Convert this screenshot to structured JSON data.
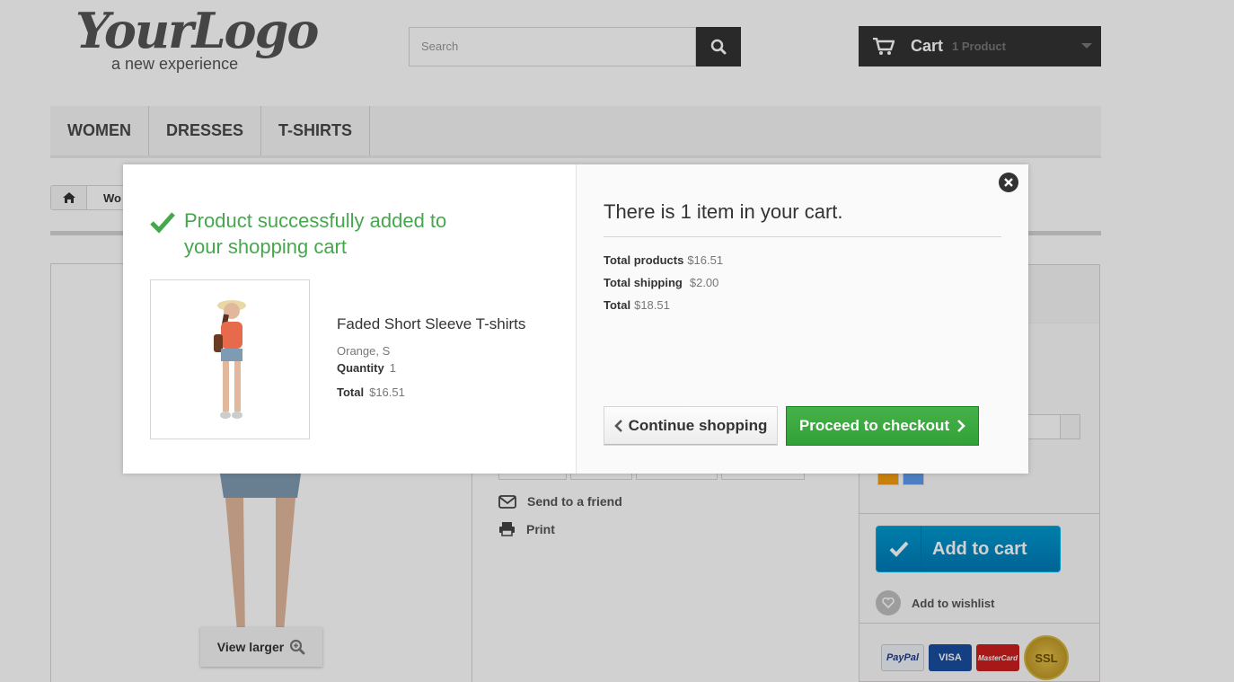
{
  "header": {
    "logo_text": "YourLogo",
    "logo_tagline": "a new experience",
    "search": {
      "placeholder": "Search"
    },
    "cart": {
      "label": "Cart",
      "count_text": "1 Product"
    }
  },
  "menu": {
    "items": [
      {
        "label": "WOMEN"
      },
      {
        "label": "DRESSES"
      },
      {
        "label": "T-SHIRTS"
      }
    ]
  },
  "breadcrumb": {
    "current": "Wo"
  },
  "product_page": {
    "view_larger": "View larger",
    "send_to_friend": "Send to a friend",
    "print": "Print",
    "add_to_cart": "Add to cart",
    "add_to_wishlist": "Add to wishlist",
    "payment_logos": [
      "PayPal",
      "VISA",
      "MasterCard",
      "SSL"
    ],
    "swatch_colors": [
      "#f39c11",
      "#5d9cec"
    ]
  },
  "modal": {
    "success_title": "Product successfully added to your shopping cart",
    "product": {
      "name": "Faded Short Sleeve T-shirts",
      "attributes": "Orange, S",
      "quantity_label": "Quantity",
      "quantity_value": "1",
      "total_label": "Total",
      "total_value": "$16.51"
    },
    "cart_summary": "There is 1 item in your cart.",
    "totals": {
      "products_label": "Total products",
      "products_value": "$16.51",
      "shipping_label": "Total shipping",
      "shipping_value": "$2.00",
      "total_label": "Total",
      "total_value": "$18.51"
    },
    "continue_label": "Continue shopping",
    "checkout_label": "Proceed to checkout"
  },
  "colors": {
    "success_green": "#46a74e",
    "checkout_green": "#43b155",
    "add_to_cart_blue": "#009ad0",
    "dark": "#333333"
  }
}
